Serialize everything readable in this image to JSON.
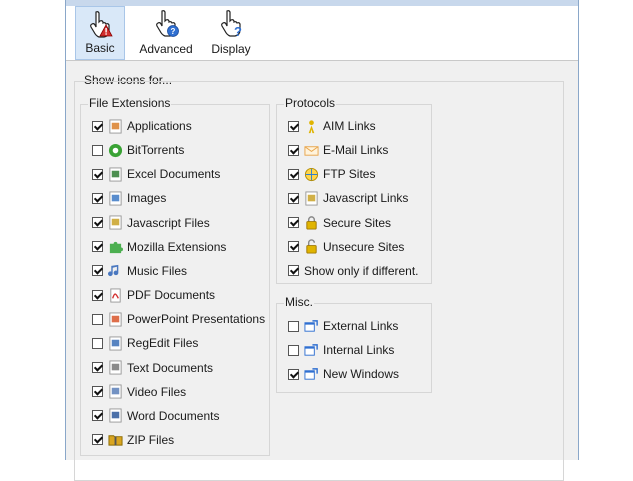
{
  "tabs": [
    {
      "label": "Basic",
      "icon": "hand-warning-icon",
      "active": true
    },
    {
      "label": "Advanced",
      "icon": "hand-help-icon",
      "active": false
    },
    {
      "label": "Display",
      "icon": "hand-question-icon",
      "active": false
    }
  ],
  "show_icons_for": "Show icons for...",
  "file_extensions": {
    "title": "File Extensions",
    "items": [
      {
        "label": "Applications",
        "checked": true,
        "icon": "application-icon",
        "color": "#d97f2a"
      },
      {
        "label": "BitTorrents",
        "checked": false,
        "icon": "bittorrent-icon",
        "color": "#3aa335"
      },
      {
        "label": "Excel Documents",
        "checked": true,
        "icon": "excel-icon",
        "color": "#2e7d32"
      },
      {
        "label": "Images",
        "checked": true,
        "icon": "image-icon",
        "color": "#3b78c4"
      },
      {
        "label": "Javascript Files",
        "checked": true,
        "icon": "javascript-file-icon",
        "color": "#c9a227"
      },
      {
        "label": "Mozilla Extensions",
        "checked": true,
        "icon": "puzzle-icon",
        "color": "#4caf50"
      },
      {
        "label": "Music Files",
        "checked": true,
        "icon": "music-note-icon",
        "color": "#4a78c0"
      },
      {
        "label": "PDF Documents",
        "checked": true,
        "icon": "pdf-icon",
        "color": "#d32f2f"
      },
      {
        "label": "PowerPoint Presentations",
        "checked": false,
        "icon": "powerpoint-icon",
        "color": "#d8552a"
      },
      {
        "label": "RegEdit Files",
        "checked": false,
        "icon": "regedit-icon",
        "color": "#3b6fb6"
      },
      {
        "label": "Text Documents",
        "checked": true,
        "icon": "text-document-icon",
        "color": "#777777"
      },
      {
        "label": "Video Files",
        "checked": true,
        "icon": "video-file-icon",
        "color": "#5b7fb8"
      },
      {
        "label": "Word Documents",
        "checked": true,
        "icon": "word-icon",
        "color": "#2b579a"
      },
      {
        "label": "ZIP Files",
        "checked": true,
        "icon": "zip-folder-icon",
        "color": "#d9a520"
      }
    ]
  },
  "protocols": {
    "title": "Protocols",
    "items": [
      {
        "label": "AIM Links",
        "checked": true,
        "icon": "aim-icon",
        "color": "#e0b400"
      },
      {
        "label": "E-Mail Links",
        "checked": true,
        "icon": "email-icon",
        "color": "#e8a44a"
      },
      {
        "label": "FTP Sites",
        "checked": true,
        "icon": "ftp-icon",
        "color": "#2f7fd1"
      },
      {
        "label": "Javascript Links",
        "checked": true,
        "icon": "javascript-link-icon",
        "color": "#c9a227"
      },
      {
        "label": "Secure Sites",
        "checked": true,
        "icon": "lock-closed-icon",
        "color": "#e0b400"
      },
      {
        "label": "Unsecure Sites",
        "checked": true,
        "icon": "lock-open-icon",
        "color": "#e0b400"
      },
      {
        "label": "Show only if different.",
        "checked": true,
        "icon": null
      }
    ]
  },
  "misc": {
    "title": "Misc.",
    "items": [
      {
        "label": "External Links",
        "checked": false,
        "icon": "external-link-icon",
        "color": "#2f6fd1"
      },
      {
        "label": "Internal Links",
        "checked": false,
        "icon": "internal-link-icon",
        "color": "#2f6fd1"
      },
      {
        "label": "New Windows",
        "checked": true,
        "icon": "new-window-icon",
        "color": "#2f6fd1"
      }
    ]
  }
}
